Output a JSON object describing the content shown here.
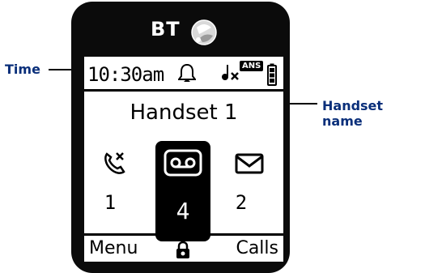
{
  "brand": {
    "logo_text": "BT"
  },
  "status": {
    "time": "10:30am",
    "ans_badge": "ANS",
    "alarm_icon": "bell-icon",
    "ringer_icon": "ringer-off-icon",
    "battery_icon": "battery-icon"
  },
  "handset": {
    "name": "Handset 1"
  },
  "tiles": [
    {
      "icon": "missed-call-icon",
      "count": "1"
    },
    {
      "icon": "voicemail-icon",
      "count": "4"
    },
    {
      "icon": "message-icon",
      "count": "2"
    }
  ],
  "softkeys": {
    "left": "Menu",
    "center_icon": "lock-icon",
    "right": "Calls"
  },
  "callouts": {
    "time": "Time",
    "handset_name": "Handset name"
  },
  "colors": {
    "callout": "#0a2f7a",
    "device": "#0b0b0b"
  }
}
